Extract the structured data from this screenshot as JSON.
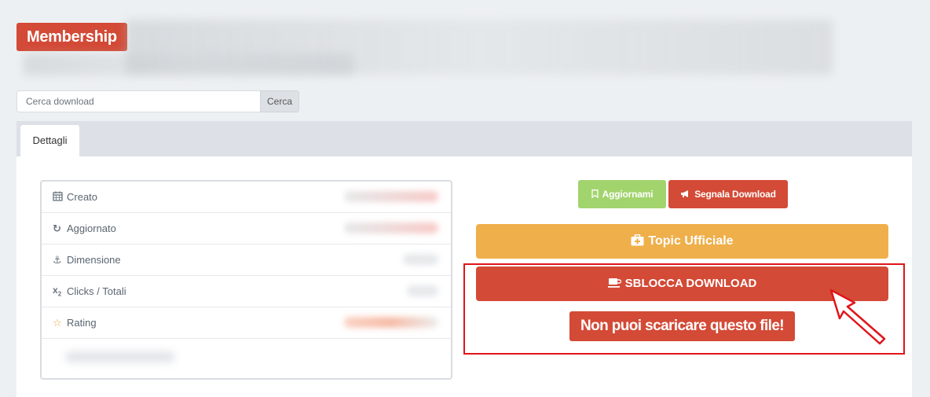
{
  "header": {
    "badge_label": "Membership"
  },
  "search": {
    "placeholder": "Cerca download",
    "button_label": "Cerca"
  },
  "tabs": [
    {
      "label": "Dettagli"
    }
  ],
  "details": {
    "rows": [
      {
        "icon": "calendar-icon",
        "label": "Creato"
      },
      {
        "icon": "refresh-icon",
        "label": "Aggiornato"
      },
      {
        "icon": "anchor-icon",
        "label": "Dimensione"
      },
      {
        "icon": "subscript-icon",
        "label": "Clicks / Totali"
      },
      {
        "icon": "star-icon",
        "label": "Rating"
      }
    ]
  },
  "actions": {
    "aggiornami_label": "Aggiornami",
    "segnala_label": "Segnala Download",
    "topic_label": "Topic Ufficiale",
    "sblocca_label": "SBLOCCA DOWNLOAD",
    "warning_text": "Non puoi scaricare questo file!"
  },
  "colors": {
    "brand_red": "#d34a36",
    "green": "#a2d46e",
    "orange": "#efaf4a",
    "highlight_red": "#e0151a"
  }
}
